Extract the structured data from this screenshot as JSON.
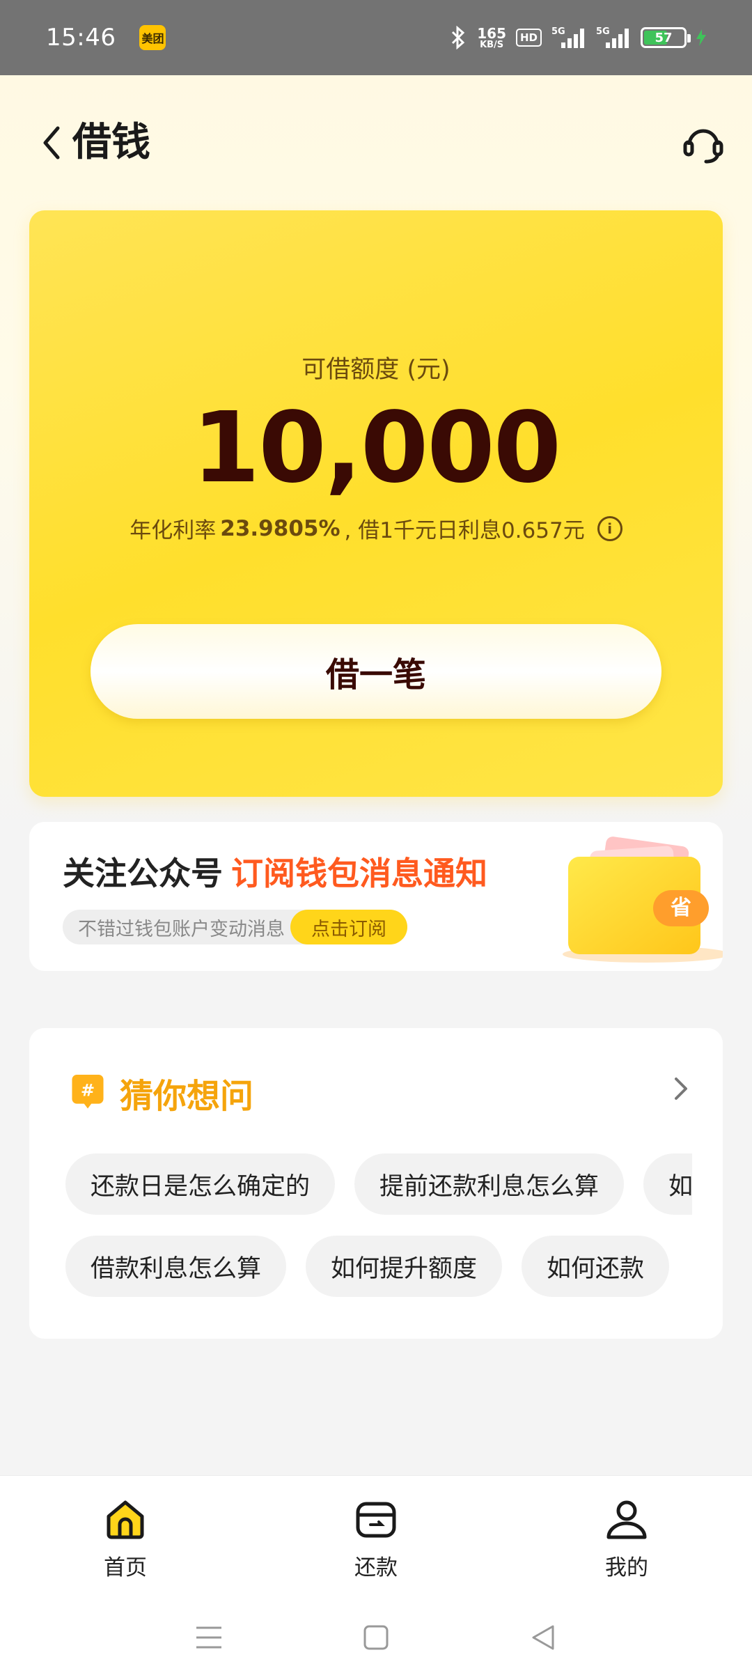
{
  "status_bar": {
    "time": "15:46",
    "app_badge": "美团",
    "net_speed": "165",
    "net_unit": "KB/S",
    "hd": "HD",
    "signal1": "5G",
    "signal2": "5G",
    "battery": "57"
  },
  "header": {
    "title": "借钱"
  },
  "credit_card": {
    "label": "可借额度 (元)",
    "amount": "10,000",
    "rate_prefix": "年化利率",
    "rate_value": "23.9805%",
    "rate_suffix": ", 借1千元日利息0.657元",
    "info_glyph": "i",
    "borrow_button": "借一笔"
  },
  "banner": {
    "title": "关注公众号",
    "highlight": "订阅钱包消息通知",
    "subtitle": "不错过钱包账户变动消息",
    "subscribe_button": "点击订阅",
    "wallet_badge": "省"
  },
  "guess": {
    "title": "猜你想问",
    "hash": "#",
    "row1": [
      "还款日是怎么确定的",
      "提前还款利息怎么算",
      "如何借款"
    ],
    "row2": [
      "借款利息怎么算",
      "如何提升额度",
      "如何还款"
    ]
  },
  "bottom_nav": [
    {
      "label": "首页",
      "icon": "home-icon",
      "active": true
    },
    {
      "label": "还款",
      "icon": "wallet-icon",
      "active": false
    },
    {
      "label": "我的",
      "icon": "user-icon",
      "active": false
    }
  ],
  "colors": {
    "brand_yellow": "#ffd51a",
    "accent_orange": "#ff5a1f",
    "amount_text": "#3a0a04",
    "guess_title": "#f5a40c"
  }
}
